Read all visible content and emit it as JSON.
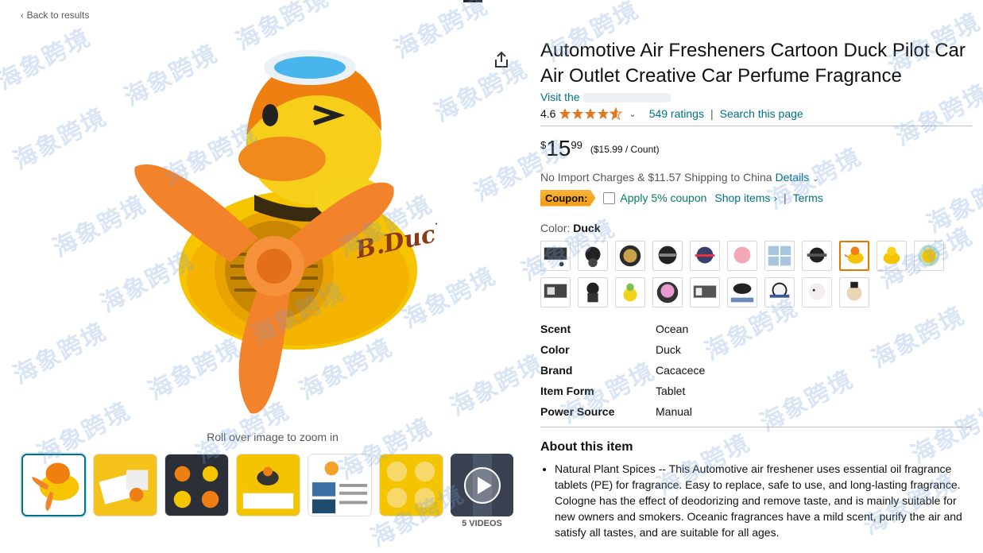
{
  "nav": {
    "back_label": "Back to results",
    "back_chevron": "‹"
  },
  "gallery": {
    "zoom_hint": "Roll over image to zoom in",
    "video_count_label": "5 VIDEOS",
    "main_image_icon": "duck-pilot-image",
    "brand_mark": "B.Duck"
  },
  "product": {
    "title": "Automotive Air Fresheners Cartoon Duck Pilot Car Air Outlet Creative Car Perfume Fragrance",
    "store_prefix": "Visit the",
    "rating_value": "4.6",
    "stars": 4.6,
    "ratings_label": "549 ratings",
    "search_page_label": "Search this page",
    "separator": "|",
    "price_symbol": "$",
    "price_whole": "15",
    "price_fraction": "99",
    "unit_price": "($15.99 / Count)",
    "shipping_text": "No Import Charges & $11.57 Shipping to China",
    "details_link": "Details",
    "coupon_badge": "Coupon:",
    "coupon_apply": "Apply 5% coupon",
    "shop_items": "Shop items ›",
    "terms": "Terms",
    "color_label": "Color:",
    "color_value": "Duck"
  },
  "specs": [
    {
      "key": "Scent",
      "value": "Ocean"
    },
    {
      "key": "Color",
      "value": "Duck"
    },
    {
      "key": "Brand",
      "value": "Cacacece"
    },
    {
      "key": "Item Form",
      "value": "Tablet"
    },
    {
      "key": "Power Source",
      "value": "Manual"
    }
  ],
  "about": {
    "heading": "About this item",
    "bullets": [
      "Natural Plant Spices -- This Automotive air freshener uses essential oil fragrance tablets (PE) for fragrance. Easy to replace, safe to use, and long-lasting fragrance. Cologne has the effect of deodorizing and remove taste, and is mainly suitable for new owners and smokers. Oceanic fragrances have a mild scent, purify the air and satisfy all tastes, and are suitable for all ages."
    ]
  },
  "watermark": "海象跨境",
  "colors": {
    "accent": "#007185",
    "coupon": "#f49b10",
    "selected_border": "#e77600",
    "star": "#de7921",
    "apply": "#067d62"
  }
}
